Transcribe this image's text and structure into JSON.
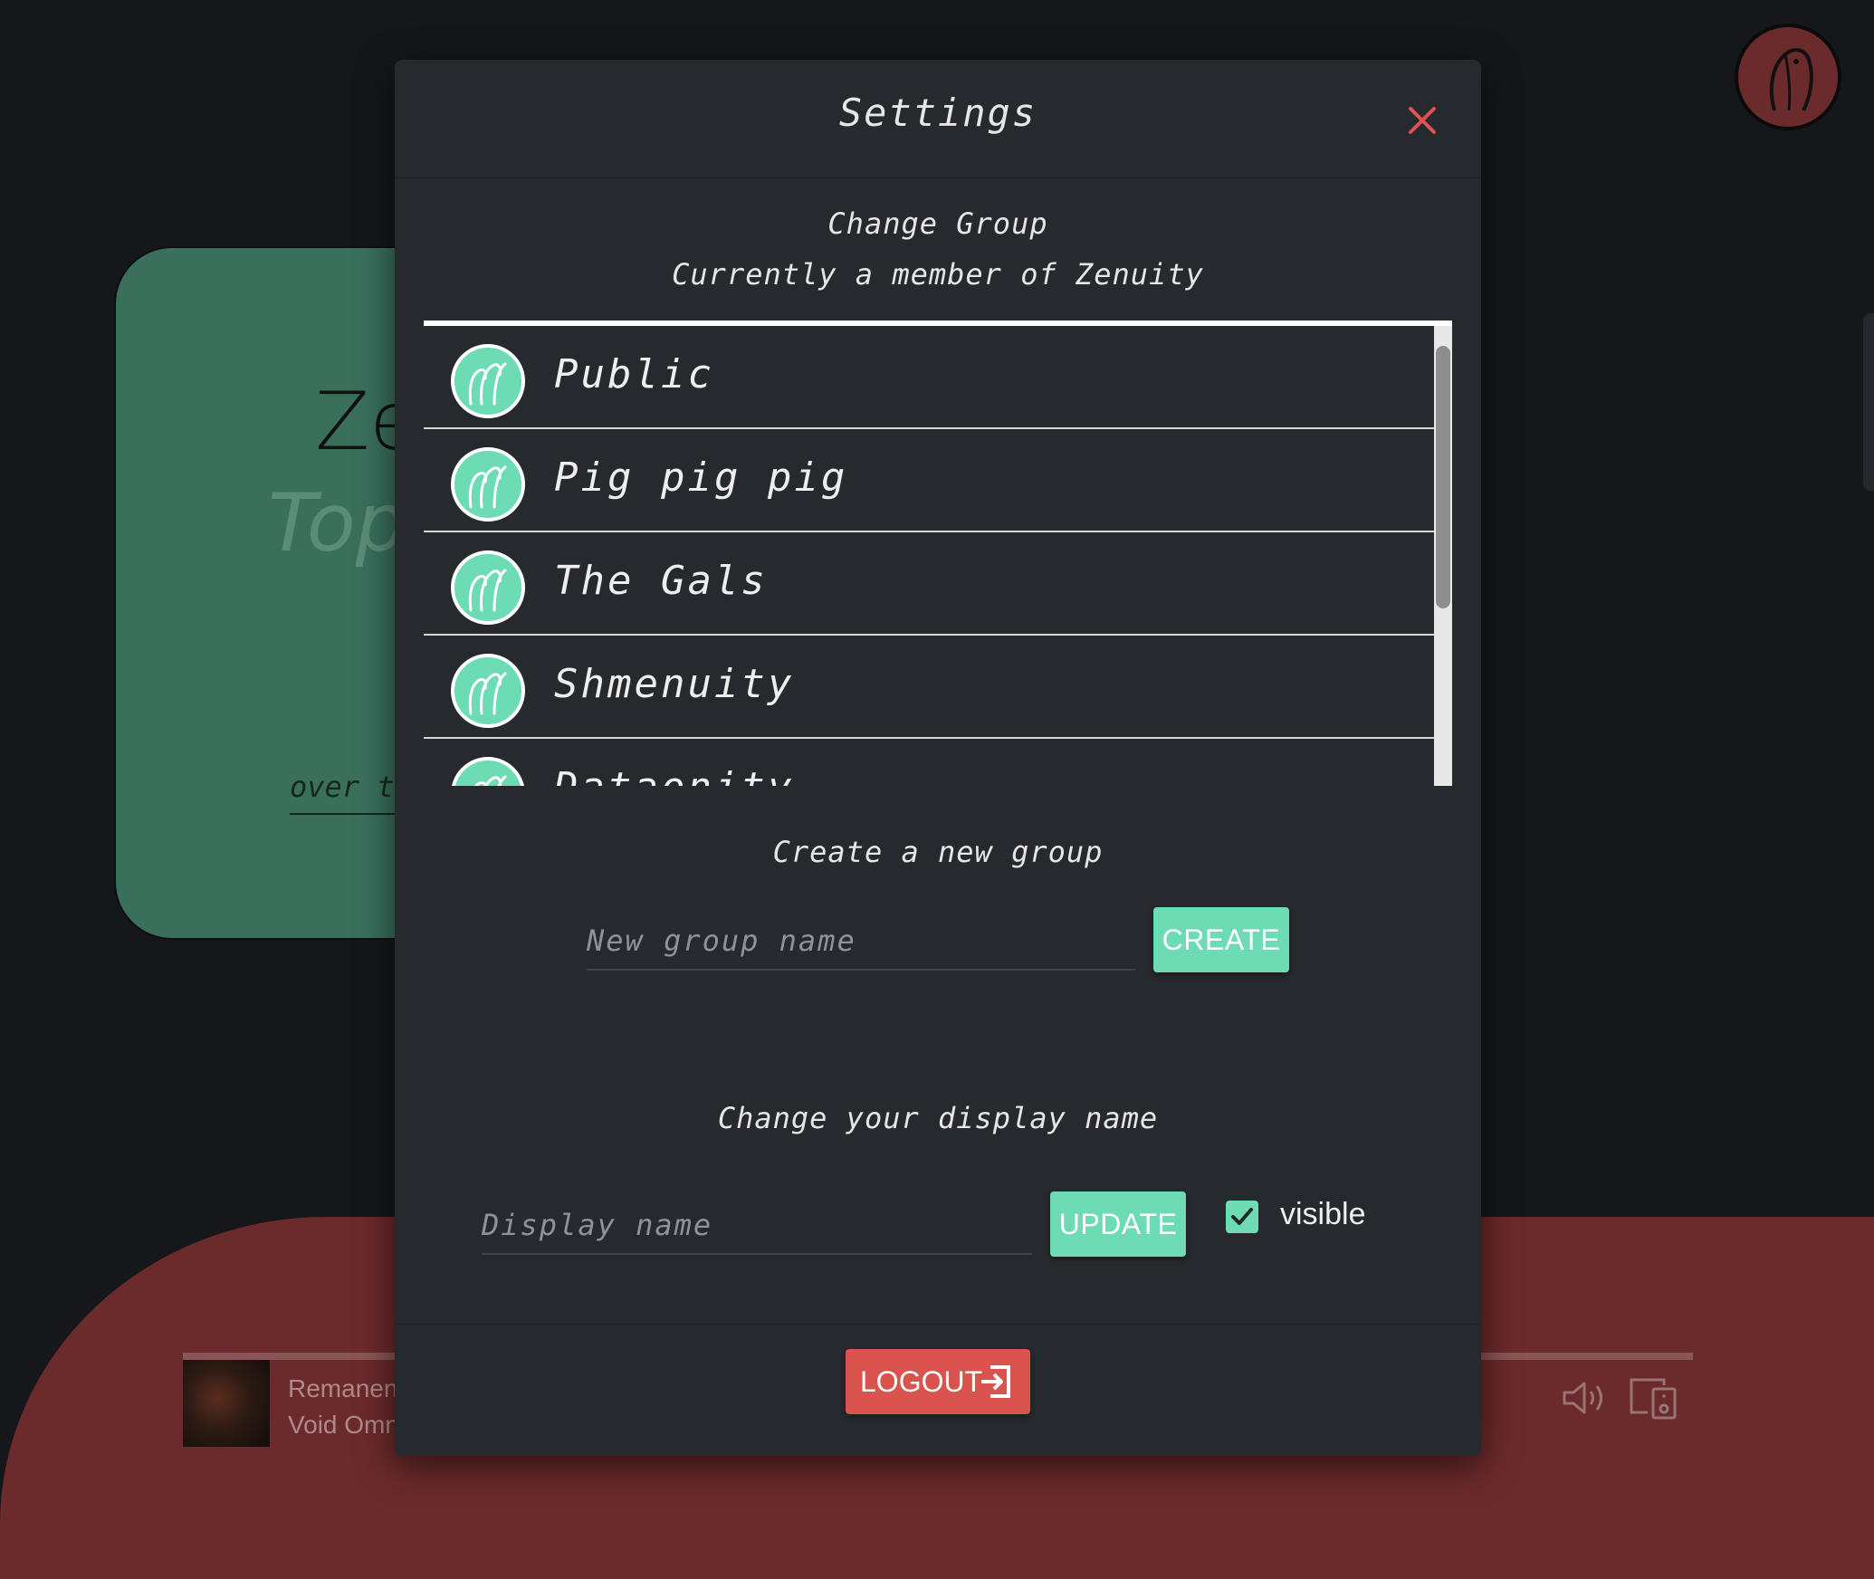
{
  "background": {
    "card": {
      "title": "Ze",
      "subtitle": "Top",
      "footer": "over t"
    },
    "player": {
      "track_title": "Remanen",
      "track_artist": "Void Omn"
    }
  },
  "modal": {
    "title": "Settings",
    "change_group": {
      "heading": "Change Group",
      "current": "Currently a member of Zenuity",
      "groups": [
        {
          "label": "Public"
        },
        {
          "label": "Pig pig pig"
        },
        {
          "label": "The Gals"
        },
        {
          "label": "Shmenuity"
        },
        {
          "label": "Dataonity"
        }
      ]
    },
    "create_group": {
      "heading": "Create a new group",
      "placeholder": "New group name",
      "button": "CREATE"
    },
    "display_name": {
      "heading": "Change your display name",
      "placeholder": "Display name",
      "button": "UPDATE",
      "visible_label": "visible",
      "visible_checked": true
    },
    "logout": "LOGOUT"
  },
  "colors": {
    "accent": "#6ddcb5",
    "danger": "#d9534f",
    "modal_bg": "#26292d",
    "blob": "#6b2a2b"
  }
}
